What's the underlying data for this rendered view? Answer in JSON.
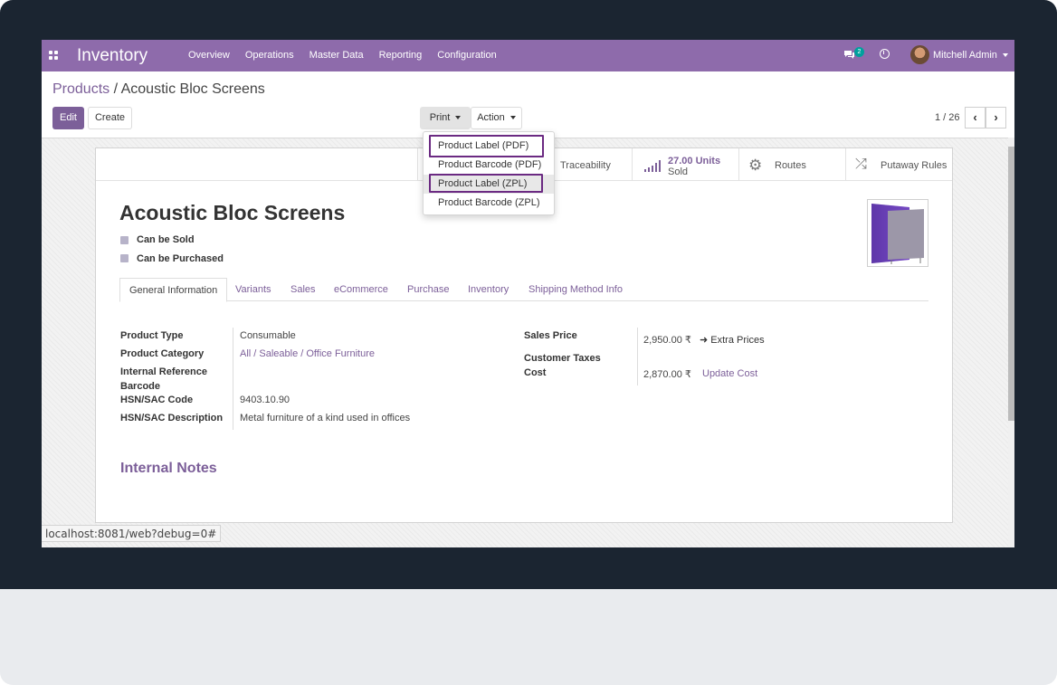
{
  "navbar": {
    "brand": "Inventory",
    "menu": [
      "Overview",
      "Operations",
      "Master Data",
      "Reporting",
      "Configuration"
    ],
    "chat_count": "2",
    "user": "Mitchell Admin"
  },
  "breadcrumb": {
    "parent": "Products",
    "separator": "/",
    "current": "Acoustic Bloc Screens"
  },
  "buttons": {
    "edit": "Edit",
    "create": "Create",
    "print": "Print",
    "action": "Action"
  },
  "pager": {
    "text": "1 / 26"
  },
  "print_menu": {
    "items": [
      "Product Label (PDF)",
      "Product Barcode (PDF)",
      "Product Label (ZPL)",
      "Product Barcode (ZPL)"
    ],
    "outlined_items": [
      "Product Label (PDF)",
      "Product Label (ZPL)"
    ]
  },
  "stat_buttons": {
    "traceability": "Traceability",
    "sold_value": "27.00 Units",
    "sold_label": "Sold",
    "routes": "Routes",
    "putaway": "Putaway Rules"
  },
  "product": {
    "name": "Acoustic Bloc Screens",
    "can_be_sold": "Can be Sold",
    "can_be_purchased": "Can be Purchased"
  },
  "tabs": [
    "General Information",
    "Variants",
    "Sales",
    "eCommerce",
    "Purchase",
    "Inventory",
    "Shipping Method Info"
  ],
  "general": {
    "product_type_label": "Product Type",
    "product_type": "Consumable",
    "category_label": "Product Category",
    "category": "All / Saleable / Office Furniture",
    "internal_ref_label": "Internal Reference",
    "barcode_label": "Barcode",
    "hsn_code_label": "HSN/SAC Code",
    "hsn_code": "9403.10.90",
    "hsn_desc_label": "HSN/SAC Description",
    "hsn_desc": "Metal furniture of a kind used in offices",
    "sales_price_label": "Sales Price",
    "sales_price": "2,950.00 ₹",
    "extra_prices": "Extra Prices",
    "customer_taxes_label": "Customer Taxes",
    "cost_label": "Cost",
    "cost": "2,870.00 ₹",
    "update_cost": "Update Cost"
  },
  "internal_notes": "Internal Notes",
  "status_url": "localhost:8081/web?debug=0#",
  "colors": {
    "brand": "#8e6bab",
    "link": "#7c5f99",
    "frame": "#1b2531",
    "highlight_box": "#6b2a82"
  }
}
